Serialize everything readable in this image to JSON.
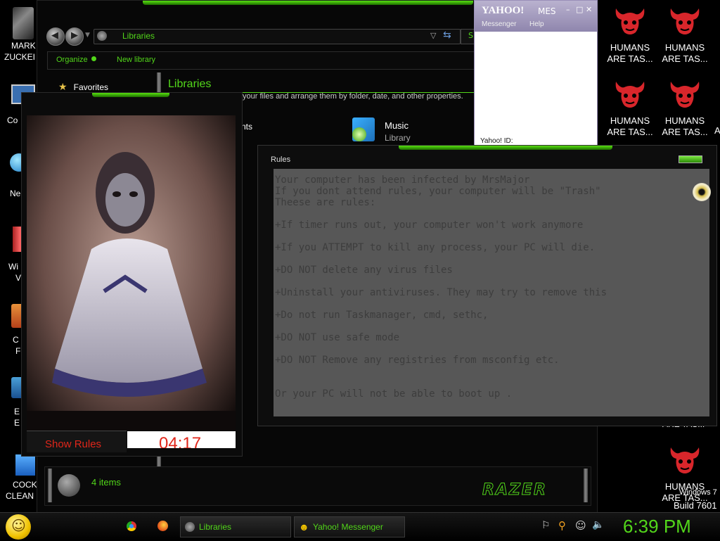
{
  "explorer": {
    "breadcrumb": "Libraries",
    "toolbar": {
      "organize": "Organize",
      "new_library": "New library"
    },
    "favorites": "Favorites",
    "heading": "Libraries",
    "description": "your files and arrange them by folder, date, and other properties.",
    "partial_item": "nts",
    "music": {
      "title": "Music",
      "subtitle": "Library"
    },
    "status": "4 items",
    "logo": "RAZER"
  },
  "yahoo": {
    "logo": "YAHOO!",
    "title_suffix": "MES",
    "menu": [
      "Messenger",
      "Help"
    ],
    "id_label": "Yahoo! ID:"
  },
  "ghost": {
    "show_rules": "Show Rules",
    "timer": "04:17"
  },
  "rules": {
    "title": "Rules",
    "lines": [
      "Your computer has been infected by MrsMajor",
      "If you dont attend rules, your computer will be \"Trash\"",
      "Theese are rules:",
      "+If timer runs out, your computer won't work anymore",
      "+If you ATTEMPT to kill any process, your PC will die.",
      "+DO NOT delete any virus files",
      "+Uninstall your antiviruses. They may try to remove this",
      "+Do not run Taskmanager, cmd, sethc,",
      "+DO NOT use safe mode",
      "+DO NOT Remove any registries from msconfig etc.",
      "Or your PC will not be able to boot up ."
    ]
  },
  "desktop": {
    "left_labels": [
      "MARK",
      "ZUCKEI",
      "Co",
      "Ne",
      "Wi",
      "V",
      "C",
      "F",
      "E",
      "E",
      "COCK",
      "CLEAN"
    ],
    "right_icons": [
      {
        "line1": "HUMANS",
        "line2": "ARE TAS..."
      },
      {
        "line1": "HUMANS",
        "line2": "ARE TAS..."
      },
      {
        "line1": "HUMANS",
        "line2": "ARE TAS..."
      },
      {
        "line1": "HUMANS",
        "line2": "ARE TAS..."
      },
      {
        "line1": "HUMANS",
        "line2": "ARE TAS..."
      }
    ],
    "partial_right": [
      "ARE TAS...",
      "A"
    ],
    "watermark": {
      "line1": "Windows 7",
      "line2": "Build 7601"
    }
  },
  "taskbar": {
    "tasks": [
      "Libraries",
      "Yahoo! Messenger"
    ],
    "clock": "6:39 PM"
  },
  "colors": {
    "accent": "#52d61a",
    "timer": "#e0261a",
    "demon": "#d8262b"
  }
}
